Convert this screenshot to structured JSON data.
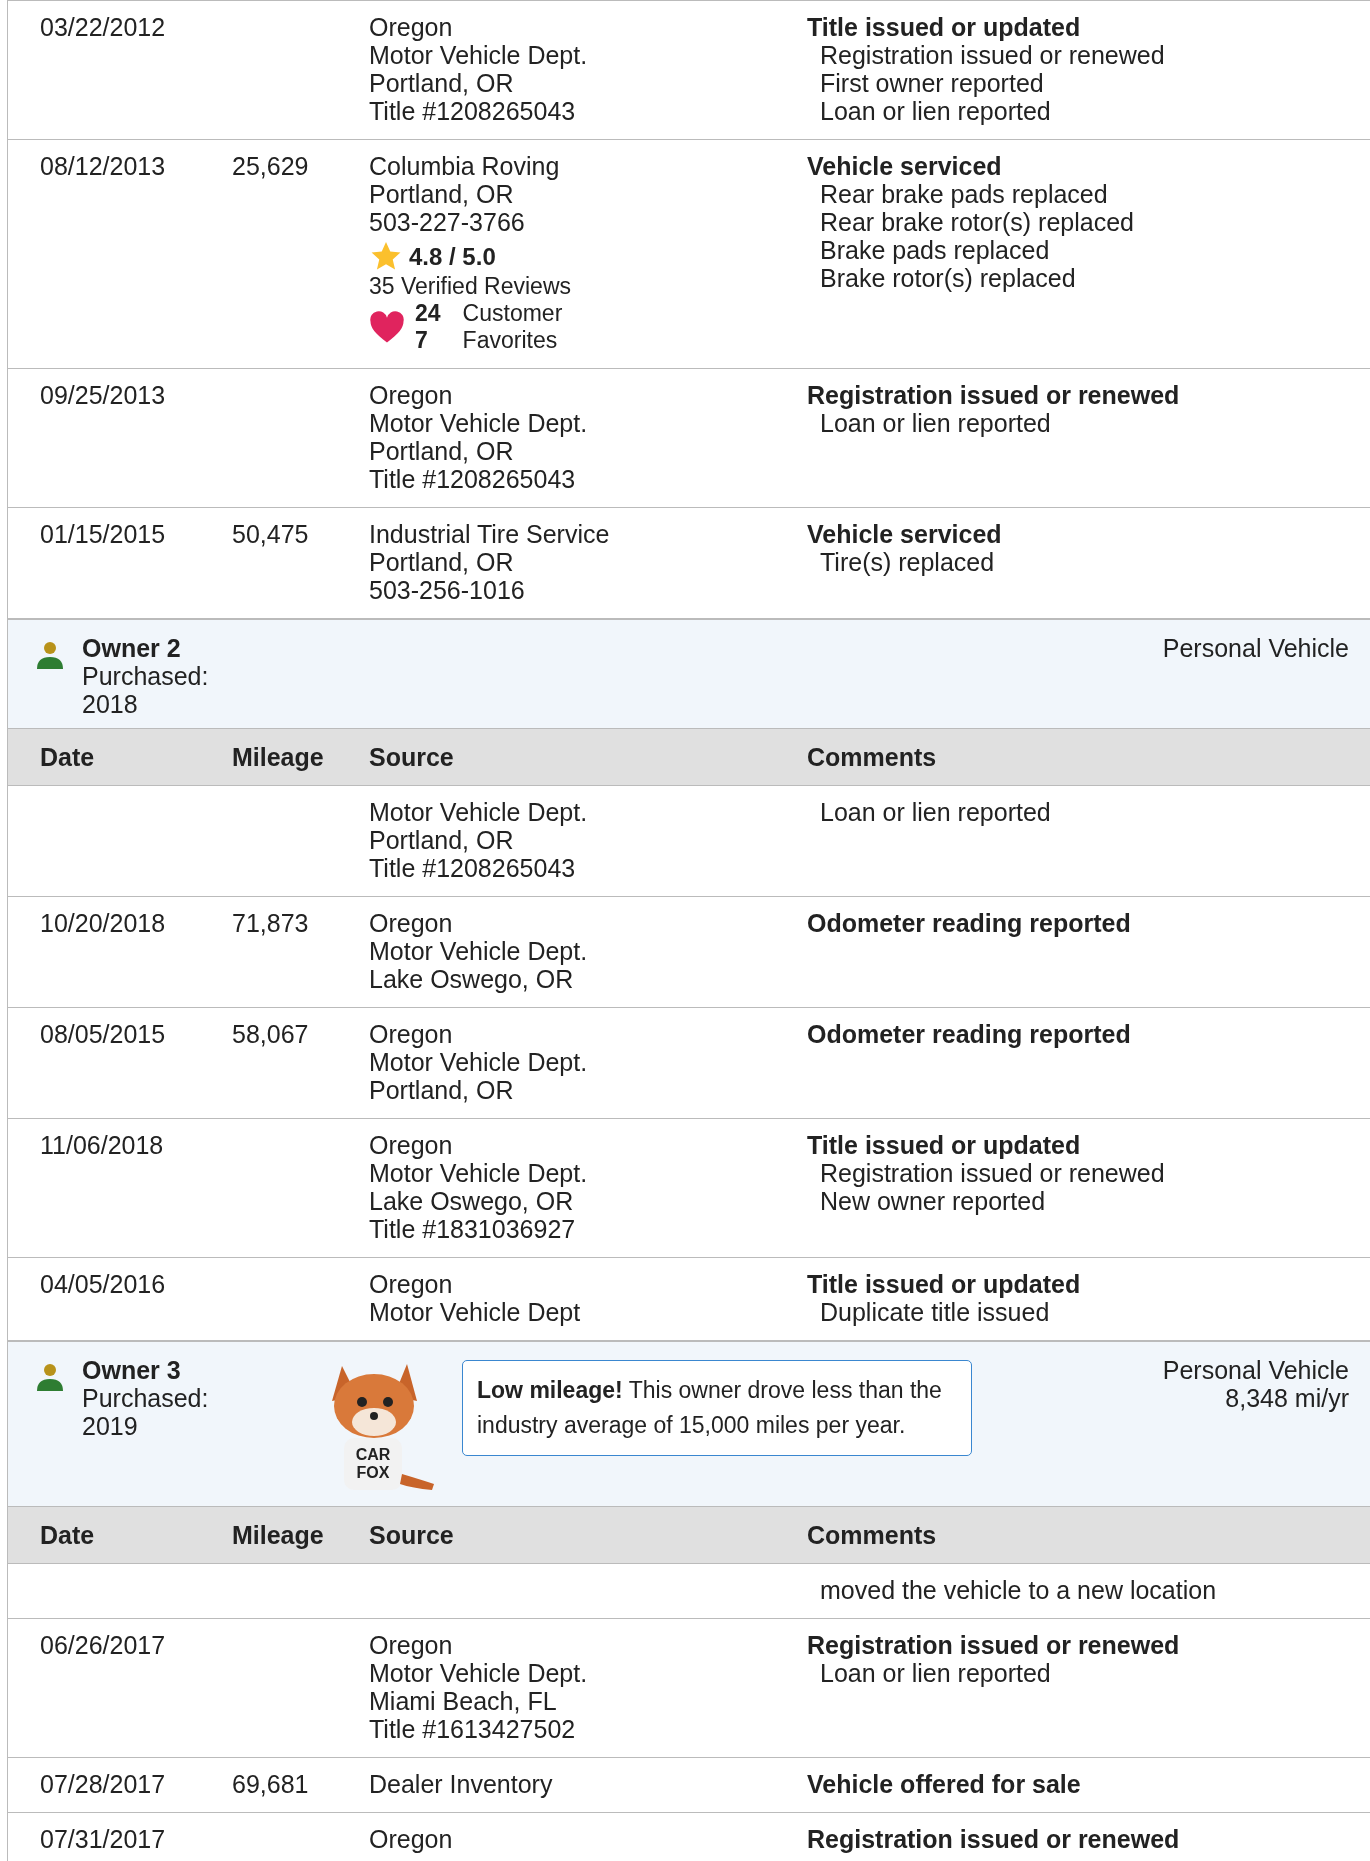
{
  "sections": [
    {
      "kind": "rows",
      "rows": [
        {
          "date": "03/22/2012",
          "source": [
            "Oregon",
            "Motor Vehicle Dept.",
            "Portland, OR",
            "Title #1208265043"
          ],
          "comments": {
            "title": "Title issued or updated",
            "details": [
              "Registration issued or renewed",
              "First owner reported",
              "Loan or lien reported"
            ]
          }
        },
        {
          "date": "08/12/2013",
          "mileage": "25,629",
          "source": [
            "Columbia Roving",
            "Portland, OR",
            "503-227-3766"
          ],
          "rating": {
            "score": "4.8 / 5.0",
            "reviews": "35 Verified Reviews",
            "favorite_counts": [
              "24",
              "7"
            ],
            "favorite_labels": [
              "Customer",
              "Favorites"
            ]
          },
          "comments": {
            "title": "Vehicle serviced",
            "details": [
              "Rear brake pads replaced",
              "Rear brake rotor(s) replaced",
              "Brake pads replaced",
              "Brake rotor(s) replaced"
            ]
          }
        },
        {
          "date": "09/25/2013",
          "source": [
            "Oregon",
            "Motor Vehicle Dept.",
            "Portland, OR",
            "Title #1208265043"
          ],
          "comments": {
            "title": "Registration issued or renewed",
            "details": [
              "Loan or lien reported"
            ]
          }
        },
        {
          "date": "01/15/2015",
          "mileage": "50,475",
          "source": [
            "Industrial Tire Service",
            "Portland, OR",
            "503-256-1016"
          ],
          "comments": {
            "title": "Vehicle serviced",
            "details": [
              "Tire(s) replaced"
            ]
          }
        }
      ]
    },
    {
      "kind": "owner",
      "owner": "Owner 2",
      "purchased": [
        "Purchased:",
        "2018"
      ],
      "usage": [
        "Personal Vehicle"
      ]
    },
    {
      "kind": "columns",
      "columns": [
        "Date",
        "Mileage",
        "Source",
        "Comments"
      ]
    },
    {
      "kind": "rows",
      "rows": [
        {
          "source": [
            "Motor Vehicle Dept.",
            "Portland, OR",
            "Title #1208265043"
          ],
          "comments": {
            "details": [
              "Loan or lien reported"
            ]
          }
        },
        {
          "date": "10/20/2018",
          "mileage": "71,873",
          "source": [
            "Oregon",
            "Motor Vehicle Dept.",
            "Lake Oswego, OR"
          ],
          "comments": {
            "title": "Odometer reading reported"
          }
        },
        {
          "date": "08/05/2015",
          "mileage": "58,067",
          "source": [
            "Oregon",
            "Motor Vehicle Dept.",
            "Portland, OR"
          ],
          "comments": {
            "title": "Odometer reading reported"
          }
        },
        {
          "date": "11/06/2018",
          "source": [
            "Oregon",
            "Motor Vehicle Dept.",
            "Lake Oswego, OR",
            "Title #1831036927"
          ],
          "comments": {
            "title": "Title issued or updated",
            "details": [
              "Registration issued or renewed",
              "New owner reported"
            ]
          }
        },
        {
          "date": "04/05/2016",
          "source": [
            "Oregon",
            "Motor Vehicle Dept"
          ],
          "comments": {
            "title": "Title issued or updated",
            "details": [
              "Duplicate title issued"
            ]
          }
        }
      ]
    },
    {
      "kind": "owner",
      "owner": "Owner 3",
      "purchased": [
        "Purchased:",
        "2019"
      ],
      "usage": [
        "Personal Vehicle",
        "8,348 mi/yr"
      ],
      "mascot_shirt": [
        "CAR",
        "FOX"
      ],
      "callout": "**Low mileage!** This owner drove less than the industry average of 15,000 miles per year."
    },
    {
      "kind": "columns",
      "columns": [
        "Date",
        "Mileage",
        "Source",
        "Comments"
      ]
    },
    {
      "kind": "rows",
      "rows": [
        {
          "comments": {
            "details": [
              "moved the vehicle to a new location"
            ]
          }
        },
        {
          "date": "06/26/2017",
          "source": [
            "Oregon",
            "Motor Vehicle Dept.",
            "Miami Beach, FL",
            "Title #1613427502"
          ],
          "comments": {
            "title": "Registration issued or renewed",
            "details": [
              "Loan or lien reported"
            ]
          }
        },
        {
          "date": "07/28/2017",
          "mileage": "69,681",
          "source": [
            "Dealer Inventory"
          ],
          "comments": {
            "title": "Vehicle offered for sale"
          }
        },
        {
          "date": "07/31/2017",
          "source": [
            "Oregon"
          ],
          "comments": {
            "title": "Registration issued or renewed"
          }
        }
      ]
    }
  ]
}
